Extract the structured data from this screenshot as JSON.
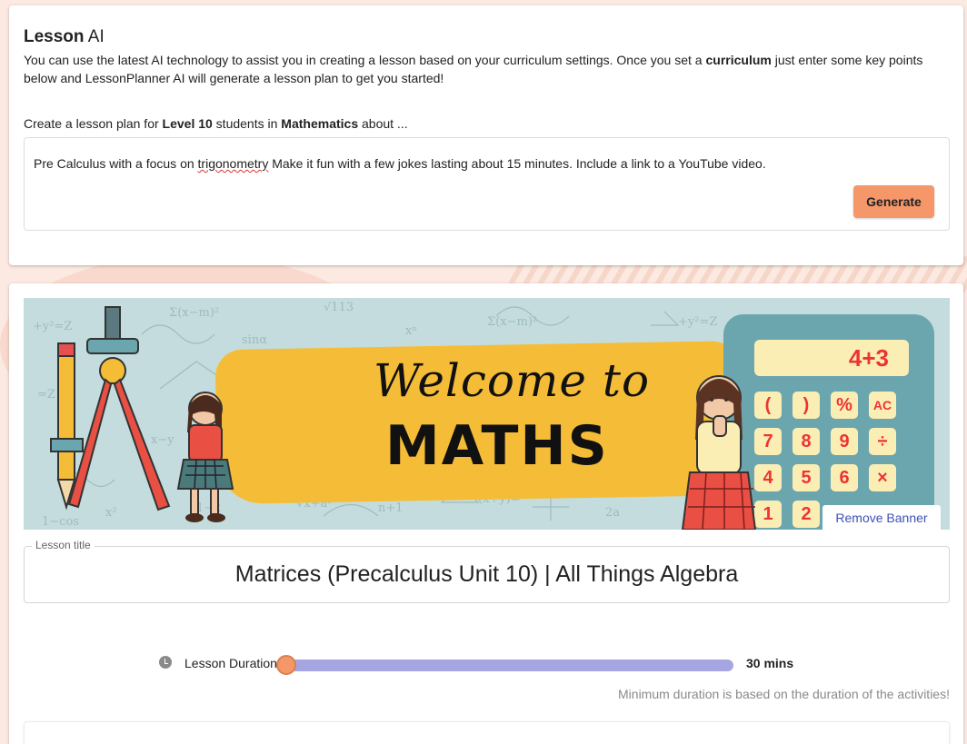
{
  "ai_card": {
    "title_bold": "Lesson",
    "title_rest": "AI",
    "desc_part1": "You can use the latest AI technology to assist you in creating a lesson based on your curriculum settings. Once you set a ",
    "desc_bold": "curriculum",
    "desc_part2": " just enter some key points below and LessonPlanner AI will generate a lesson plan to get you started!",
    "prompt_part1": "Create a lesson plan for ",
    "prompt_level": "Level 10",
    "prompt_part2": " students in ",
    "prompt_subject": "Mathematics",
    "prompt_part3": " about ...",
    "input_before": "Pre Calculus with a focus on ",
    "input_misspelled": "trigonometry",
    "input_after": " Make it fun with a few jokes lasting about 15 minutes. Include a link to a YouTube video.",
    "generate_label": "Generate"
  },
  "banner": {
    "welcome_text": "Welcome to",
    "maths_text": "MATHS",
    "calc_display": "4+3",
    "keys": [
      "(",
      ")",
      "%",
      "AC",
      "7",
      "8",
      "9",
      "÷",
      "4",
      "5",
      "6",
      "×",
      "1",
      "2"
    ],
    "remove_label": "Remove Banner"
  },
  "lesson": {
    "title_label": "Lesson title",
    "title_value": "Matrices (Precalculus Unit 10) | All Things Algebra",
    "duration_label": "Lesson Duration",
    "duration_value": "30 mins",
    "duration_fraction": 0.0,
    "min_note": "Minimum duration is based on the duration of the activities!"
  },
  "colors": {
    "accent_orange": "#f6976a",
    "slider_track": "#a5a6e1",
    "link_blue": "#3f51b5",
    "banner_yellow": "#f5bd37",
    "calculator_teal": "#6ba5ad"
  }
}
